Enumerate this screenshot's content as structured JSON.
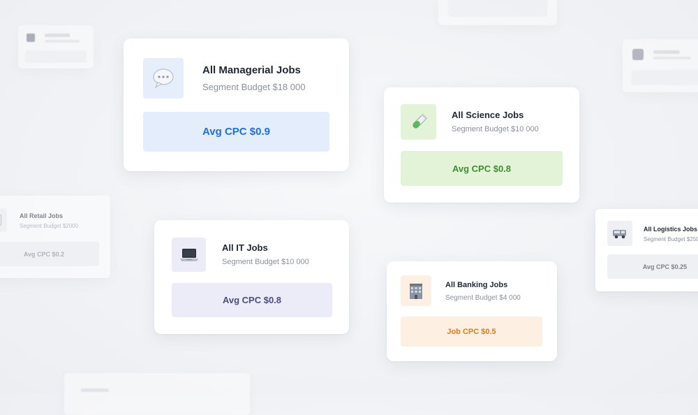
{
  "cards": {
    "managerial": {
      "title": "All Managerial Jobs",
      "budget": "Segment Budget $18 000",
      "cpc": "Avg CPC $0.9",
      "icon": "speech-bubble-icon",
      "accent": "#1f6fd6"
    },
    "science": {
      "title": "All Science Jobs",
      "budget": "Segment Budget $10 000",
      "cpc": "Avg CPC $0.8",
      "icon": "test-tube-icon",
      "accent": "#3f8f2e"
    },
    "retail": {
      "title": "All Retail Jobs",
      "budget": "Segment Budget $2000",
      "cpc": "Avg CPC $0.2",
      "icon": "shop-icon",
      "accent": "#7b818c"
    },
    "it": {
      "title": "All IT Jobs",
      "budget": "Segment Budget $10 000",
      "cpc": "Avg CPC $0.8",
      "icon": "laptop-icon",
      "accent": "#4a4f7a"
    },
    "banking": {
      "title": "All Banking Jobs",
      "budget": "Segment Budget $4 000",
      "cpc": "Job CPC $0.5",
      "icon": "office-building-icon",
      "accent": "#e07b1a"
    },
    "logistics": {
      "title": "All Logistics Jobs",
      "budget": "Segment Budget $250",
      "cpc": "Avg CPC $0.25",
      "icon": "van-icon",
      "accent": "#7b818c"
    }
  }
}
